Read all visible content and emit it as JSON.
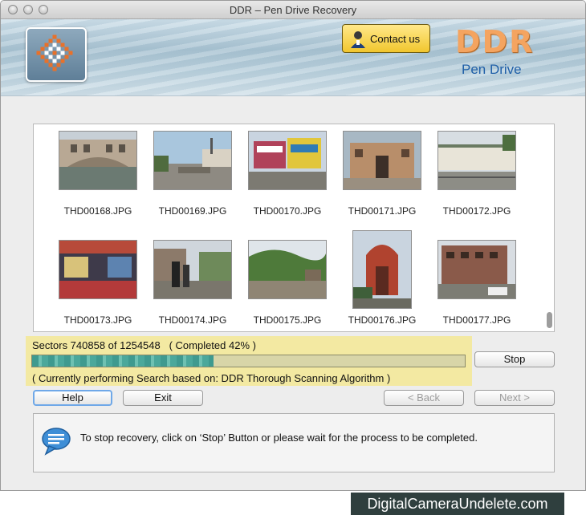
{
  "window": {
    "title": "DDR – Pen Drive Recovery"
  },
  "header": {
    "contact_label": "Contact us",
    "brand_name": "DDR",
    "brand_sub": "Pen Drive"
  },
  "gallery": {
    "items": [
      {
        "filename": "THD00168.JPG",
        "scene": "bridge"
      },
      {
        "filename": "THD00169.JPG",
        "scene": "harbor"
      },
      {
        "filename": "THD00170.JPG",
        "scene": "market"
      },
      {
        "filename": "THD00171.JPG",
        "scene": "fort"
      },
      {
        "filename": "THD00172.JPG",
        "scene": "station"
      },
      {
        "filename": "THD00173.JPG",
        "scene": "mall"
      },
      {
        "filename": "THD00174.JPG",
        "scene": "street"
      },
      {
        "filename": "THD00175.JPG",
        "scene": "trail"
      },
      {
        "filename": "THD00176.JPG",
        "scene": "temple"
      },
      {
        "filename": "THD00177.JPG",
        "scene": "building"
      }
    ]
  },
  "progress": {
    "sectors_text": "Sectors 740858 of 1254548   ( Completed 42% )",
    "completed_fraction": 0.42,
    "status_text": "( Currently performing Search based on: DDR Thorough Scanning Algorithm )"
  },
  "buttons": {
    "stop": "Stop",
    "help": "Help",
    "exit": "Exit",
    "back": "< Back",
    "next": "Next >"
  },
  "info": {
    "message": "To stop recovery, click on ‘Stop’ Button or please wait for the process to be completed."
  },
  "footer": {
    "site": "DigitalCameraUndelete.com"
  },
  "colors": {
    "progress_panel": "#f3e9a2",
    "progress_fill": "#4ba89b",
    "brand": "#f4a460",
    "brand_sub": "#1f5fa8"
  }
}
